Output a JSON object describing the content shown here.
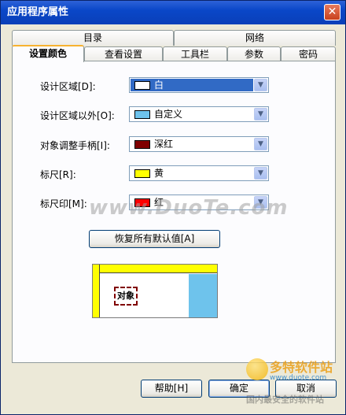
{
  "window": {
    "title": "应用程序属性",
    "close_glyph": "✕"
  },
  "tabs": {
    "row1": [
      "目录",
      "网络"
    ],
    "row2": [
      "设置颜色",
      "查看设置",
      "工具栏",
      "参数",
      "密码"
    ],
    "active": "设置颜色"
  },
  "color_rows": [
    {
      "label": "设计区域[D]:",
      "value": "白",
      "swatch": "#ffffff",
      "selected": true
    },
    {
      "label": "设计区域以外[O]:",
      "value": "自定义",
      "swatch": "#6ec3ec",
      "selected": false
    },
    {
      "label": "对象调整手柄[I]:",
      "value": "深红",
      "swatch": "#800000",
      "selected": false
    },
    {
      "label": "标尺[R]:",
      "value": "黄",
      "swatch": "#ffff00",
      "selected": false
    },
    {
      "label": "标尺印[M]:",
      "value": "红",
      "swatch": "#ff0000",
      "selected": false
    }
  ],
  "restore_button": "恢复所有默认值[A]",
  "preview": {
    "object_label": "对象",
    "ruler_color": "#ffff00",
    "outside_color": "#6ec3ec",
    "handle_color": "#800000"
  },
  "footer": {
    "help": "帮助[H]",
    "ok": "确定",
    "cancel": "取消"
  },
  "watermarks": {
    "center": "www.DuoTe.com",
    "logo": "多特软件站",
    "logo_sub": "国内最安全的软件站",
    "logo_url": "www.duote.com"
  }
}
